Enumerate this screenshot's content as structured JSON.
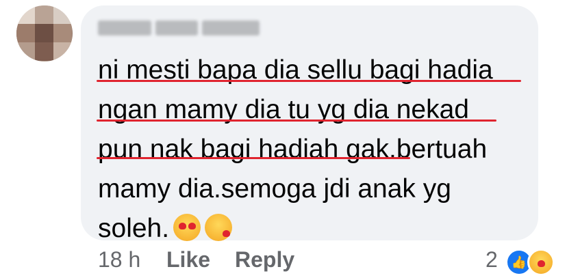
{
  "comment": {
    "author_name": "",
    "lines": [
      "ni mesti bapa dia sellu bagi hadia",
      "ngan mamy dia tu yg dia nekad",
      "pun nak bagi hadiah gak.bertuah",
      "mamy dia.semoga jdi anak yg",
      "soleh."
    ]
  },
  "footer": {
    "time": "18 h",
    "like_label": "Like",
    "reply_label": "Reply",
    "reaction_count": "2"
  },
  "icons": {
    "emoji_1": "heart-eyes-emoji-icon",
    "emoji_2": "kissing-heart-emoji-icon",
    "reaction_1": "like-reaction-icon",
    "reaction_2": "care-reaction-icon"
  },
  "colors": {
    "bubble": "#f0f2f5",
    "text": "#050505",
    "meta": "#65676b",
    "underline": "#e0242f",
    "like_blue": "#1877f2"
  }
}
